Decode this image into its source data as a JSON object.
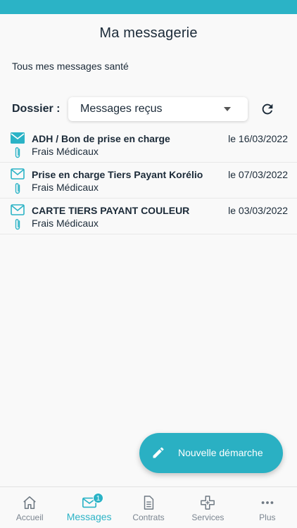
{
  "header": {
    "title": "Ma messagerie",
    "subtitle": "Tous mes messages santé"
  },
  "folder": {
    "label": "Dossier :",
    "selected": "Messages reçus"
  },
  "messages": [
    {
      "subject": "ADH / Bon de prise en charge",
      "category": "Frais Médicaux",
      "date": "le 16/03/2022"
    },
    {
      "subject": "Prise en charge Tiers Payant Korélio",
      "category": "Frais Médicaux",
      "date": "le 07/03/2022"
    },
    {
      "subject": "CARTE TIERS PAYANT COULEUR",
      "category": "Frais Médicaux",
      "date": "le 03/03/2022"
    }
  ],
  "fab": {
    "label": "Nouvelle démarche",
    "icon": "pencil-icon"
  },
  "tabs": [
    {
      "label": "Accueil",
      "icon": "home-icon"
    },
    {
      "label": "Messages",
      "icon": "envelope-icon",
      "badge": "1"
    },
    {
      "label": "Contrats",
      "icon": "document-icon"
    },
    {
      "label": "Services",
      "icon": "medical-cross-icon"
    },
    {
      "label": "Plus",
      "icon": "more-icon"
    }
  ],
  "colors": {
    "accent": "#2bb3c6",
    "text": "#1b2a38",
    "muted": "#7b8590"
  }
}
